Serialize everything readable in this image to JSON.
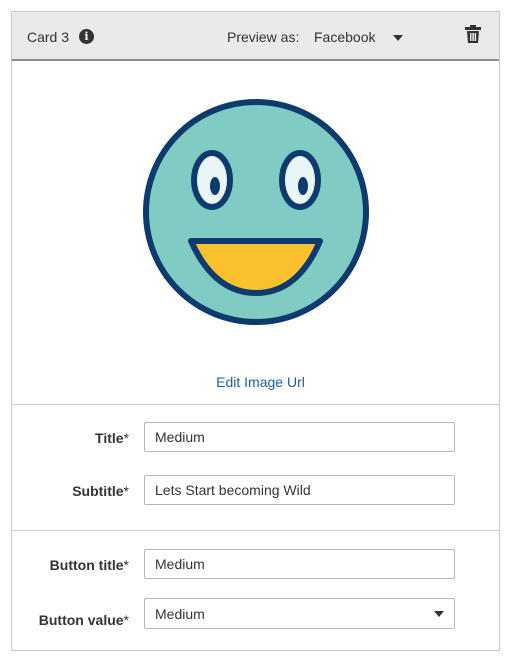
{
  "header": {
    "card_title": "Card 3",
    "info_icon_glyph": "i",
    "preview_label": "Preview as:",
    "preview_value": "Facebook",
    "icons": [
      "info-icon",
      "chevron-down-icon",
      "trash-icon"
    ]
  },
  "image": {
    "icon": "smiley-face-image",
    "edit_link": "Edit Image Url",
    "colors": {
      "face": "#80cbc4",
      "outline": "#0d3b6e",
      "mouth": "#fbc02d",
      "eye_white": "#eaf6f6"
    }
  },
  "fields": {
    "title_label": "Title",
    "title_value": "Medium",
    "subtitle_label": "Subtitle",
    "subtitle_value": "Lets Start becoming Wild",
    "button_title_label": "Button title",
    "button_title_value": "Medium",
    "button_value_label": "Button value",
    "button_value_value": "Medium",
    "required_marker": "*"
  },
  "colors": {
    "link": "#1a5ea8",
    "header_bg": "#eaeaea"
  }
}
